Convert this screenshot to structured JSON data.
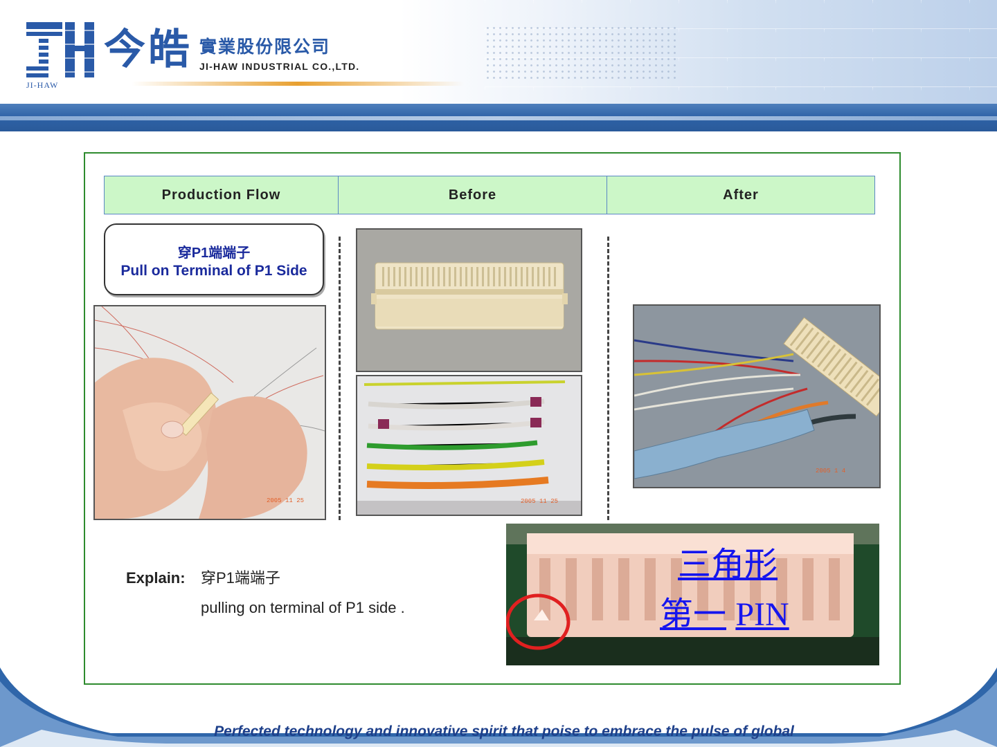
{
  "header": {
    "logo_mark": "JH",
    "logo_sub": "JI-HAW",
    "company_cn_main": "今皓",
    "company_cn_sub": "實業股份限公司",
    "company_en": "JI-HAW INDUSTRIAL CO.,LTD.",
    "brand_color": "#2a5aa8"
  },
  "table_header": {
    "col1": "Production Flow",
    "col2": "Before",
    "col3": "After",
    "bg_color": "#ccf7c8"
  },
  "step": {
    "title_cn": "穿P1端端子",
    "title_en": "Pull on Terminal of P1 Side"
  },
  "photos": {
    "hands": {
      "date": "2005 11 25"
    },
    "wires": {
      "date": "2005 11 25"
    },
    "after": {
      "date": "2005  1  4"
    }
  },
  "explain": {
    "label": "Explain:",
    "line1": "穿P1端端子",
    "line2": "pulling on terminal of  P1 side ."
  },
  "annotation": {
    "line1": "三角形",
    "line2_cn": "第一",
    "line2_en": "PIN"
  },
  "footer": {
    "slogan": "Perfected technology and innovative spirit that poise to embrace the pulse of global"
  }
}
